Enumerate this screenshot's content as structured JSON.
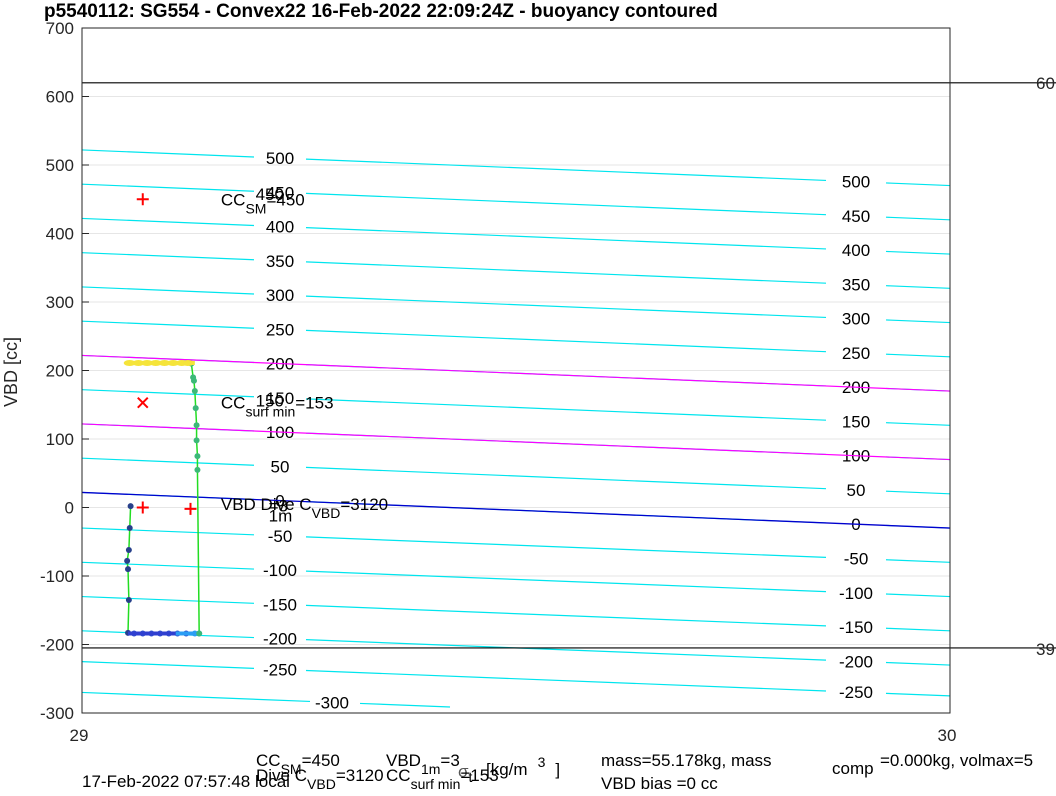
{
  "chart_data": {
    "type": "contour",
    "title": "p5540112: SG554 - Convex22 16-Feb-2022 22:09:24Z - buoyancy contoured",
    "ylabel": "VBD [cc]",
    "xlim": [
      29,
      30
    ],
    "ylim": [
      -300,
      700
    ],
    "x_ticks": [
      "29",
      "30"
    ],
    "y_ticks": [
      "-300",
      "-200",
      "-100",
      "0",
      "100",
      "200",
      "300",
      "400",
      "500",
      "600",
      "700"
    ],
    "right_axis_ticks": [
      "60",
      "39"
    ],
    "grid": true,
    "contours": {
      "color": "#00e5ee",
      "levels": [
        -300,
        -250,
        -200,
        -150,
        -100,
        -50,
        0,
        50,
        100,
        150,
        200,
        250,
        300,
        350,
        400,
        450,
        500
      ],
      "left_labels": [
        "-300",
        "-250",
        "-200",
        "-150",
        "-100",
        "-50",
        "0",
        "50",
        "100",
        "150",
        "200",
        "250",
        "300",
        "350",
        "400",
        "450",
        "500"
      ],
      "right_labels": [
        "-250",
        "-200",
        "-150",
        "-100",
        "-50",
        "0",
        "50",
        "100",
        "150",
        "200",
        "250",
        "300",
        "350",
        "400",
        "450",
        "500"
      ],
      "vbd_at_x29": [
        -270,
        -225,
        -180,
        -130,
        -80,
        -30,
        22,
        72,
        122,
        172,
        222,
        272,
        322,
        372,
        422,
        472,
        522
      ],
      "vbd_at_x30": [
        -320,
        -275,
        -230,
        -180,
        -130,
        -80,
        -30,
        20,
        70,
        120,
        170,
        220,
        270,
        320,
        370,
        420,
        470
      ]
    },
    "horizontal_lines": [
      {
        "y": 620,
        "color": "#000000"
      },
      {
        "y": -205,
        "color": "#000000"
      }
    ],
    "magenta_lines": [
      {
        "y0": 222,
        "y1": 170,
        "color": "#ff00ff"
      },
      {
        "y0": 122,
        "y1": 70,
        "color": "#ff00ff"
      }
    ],
    "blue_line": {
      "y0": 22,
      "y1": -30,
      "color": "#0000cd"
    },
    "markers": [
      {
        "x": 29.07,
        "y": 450,
        "symbol": "+",
        "color": "#ff0000"
      },
      {
        "x": 29.07,
        "y": 153,
        "symbol": "x",
        "color": "#ff0000"
      },
      {
        "x": 29.07,
        "y": 0,
        "symbol": "+",
        "color": "#ff0000"
      },
      {
        "x": 29.125,
        "y": -2,
        "symbol": "+",
        "color": "#ff0000"
      }
    ],
    "annotations": [
      {
        "x": 29.16,
        "y": 450,
        "main": "CC",
        "sub": "SM",
        "tail": "=450"
      },
      {
        "x": 29.16,
        "y": 153,
        "main": "CC",
        "sub": "surf min",
        "tail": "=153"
      },
      {
        "x": 29.16,
        "y": 5,
        "main": "VBD Dive C",
        "sub": "VBD",
        "tail": "=3120"
      }
    ],
    "annotation_overlaps": [
      {
        "x": 29.2,
        "y": 458,
        "text": "450"
      },
      {
        "x": 29.2,
        "y": 156,
        "text": "150"
      },
      {
        "x": 29.215,
        "y": 3,
        "text": "=3"
      },
      {
        "x": 29.215,
        "y": -12,
        "text": "1m"
      }
    ],
    "dive_series": {
      "line_color": "#22dd22",
      "points": [
        {
          "x": 29.056,
          "y": 2
        },
        {
          "x": 29.055,
          "y": -30
        },
        {
          "x": 29.054,
          "y": -62
        },
        {
          "x": 29.052,
          "y": -78
        },
        {
          "x": 29.053,
          "y": -90
        },
        {
          "x": 29.054,
          "y": -135
        },
        {
          "x": 29.053,
          "y": -183
        },
        {
          "x": 29.06,
          "y": -184
        },
        {
          "x": 29.07,
          "y": -184
        },
        {
          "x": 29.08,
          "y": -184
        },
        {
          "x": 29.09,
          "y": -184
        },
        {
          "x": 29.1,
          "y": -184
        },
        {
          "x": 29.11,
          "y": -184
        },
        {
          "x": 29.12,
          "y": -184
        },
        {
          "x": 29.13,
          "y": -184
        },
        {
          "x": 29.135,
          "y": -184
        }
      ],
      "climb_points": [
        {
          "x": 29.135,
          "y": -184
        },
        {
          "x": 29.133,
          "y": 55
        },
        {
          "x": 29.133,
          "y": 75
        },
        {
          "x": 29.132,
          "y": 98
        },
        {
          "x": 29.132,
          "y": 120
        },
        {
          "x": 29.131,
          "y": 145
        },
        {
          "x": 29.13,
          "y": 170
        },
        {
          "x": 29.129,
          "y": 185
        },
        {
          "x": 29.128,
          "y": 190
        },
        {
          "x": 29.126,
          "y": 210
        }
      ],
      "surface_points_x": [
        29.055,
        29.065,
        29.075,
        29.085,
        29.095,
        29.105,
        29.115,
        29.122
      ],
      "surface_y": 211
    },
    "footer": {
      "line1_left_main": "CC",
      "line1_left_sub": "SM",
      "line1_left_tail": "=450",
      "line1_mid_main": "VBD",
      "line1_mid_sub": "1m",
      "line1_mid_tail": "=3",
      "line1_sigma": "σ",
      "line1_sigma_sub": "t",
      "line1_units": "[kg/m",
      "line1_units_sup": "3",
      "line1_units_close": "]",
      "line1_mass": "mass=55.178kg, mass",
      "line1_mass_sub": "comp",
      "line1_mass_tail": "=0.000kg, volmax=5",
      "line2_date": "17-Feb-2022 07:57:48 local",
      "line2_dive": "Dive C",
      "line2_dive_sub": "VBD",
      "line2_dive_tail": "=3120",
      "line2_cc_main": "CC",
      "line2_cc_sub": "surf min",
      "line2_cc_tail": "=153",
      "line2_bias": "VBD bias =0 cc"
    }
  }
}
